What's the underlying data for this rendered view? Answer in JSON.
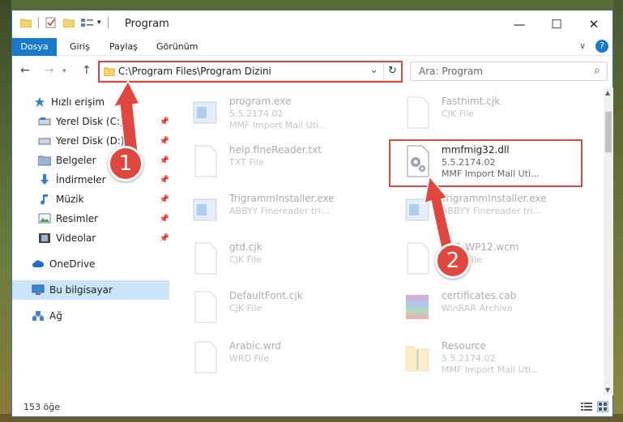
{
  "window": {
    "title": "Program",
    "minimize_icon": "—",
    "maximize_icon": "☐",
    "close_icon": "✕"
  },
  "ribbon": {
    "tabs": [
      "Dosya",
      "Giriş",
      "Paylaş",
      "Görünüm"
    ],
    "active_tab": "Dosya",
    "help_icon": "?",
    "expand_icon": "∨"
  },
  "nav": {
    "back": "←",
    "forward": "→",
    "up": "↑",
    "address": "C:\\Program Files\\Program Dizini",
    "dropdown": "⌄",
    "refresh": "↻",
    "search_placeholder": "Ara: Program",
    "search_icon": "⌕"
  },
  "sidebar": {
    "items": [
      {
        "label": "Hızlı erişim",
        "icon": "star-icon",
        "pinned": false
      },
      {
        "label": "Yerel Disk (C:)",
        "icon": "drive-icon",
        "pinned": true
      },
      {
        "label": "Yerel Disk (D:)",
        "icon": "drive-icon",
        "pinned": true
      },
      {
        "label": "Belgeler",
        "icon": "documents-icon",
        "pinned": true
      },
      {
        "label": "İndirmeler",
        "icon": "download-icon",
        "pinned": true
      },
      {
        "label": "Müzik",
        "icon": "music-icon",
        "pinned": true
      },
      {
        "label": "Resimler",
        "icon": "pictures-icon",
        "pinned": true
      },
      {
        "label": "Videolar",
        "icon": "videos-icon",
        "pinned": true
      },
      {
        "label": "OneDrive",
        "icon": "cloud-icon",
        "pinned": false
      },
      {
        "label": "Bu bilgisayar",
        "icon": "computer-icon",
        "pinned": false,
        "selected": true
      },
      {
        "label": "Ağ",
        "icon": "network-icon",
        "pinned": false
      }
    ],
    "pin_glyph": "📌"
  },
  "files": [
    {
      "name": "program.exe",
      "line2": "5.5.2174.02",
      "line3": "MMF Import Mail Uti...",
      "icon": "exe-icon"
    },
    {
      "name": "Fasthimt.cjk",
      "line2": "CJK File",
      "line3": "",
      "icon": "file-icon"
    },
    {
      "name": "help.fineReader.txt",
      "line2": "TXT File",
      "line3": "",
      "icon": "file-icon"
    },
    {
      "name": "mmfmig32.dll",
      "line2": "5.5.2174.02",
      "line3": "MMF Import Mail Uti...",
      "icon": "dll-icon",
      "highlighted": true
    },
    {
      "name": "TrigrammInstaller.exe",
      "line2": "ABBYY Finereader tri...",
      "line3": "",
      "icon": "exe-icon"
    },
    {
      "name": "TrigrammInstaller.exe",
      "line2": "ABBYY Finereader tri...",
      "line3": "",
      "icon": "exe-icon"
    },
    {
      "name": "gtd.cjk",
      "line2": "CJK File",
      "line3": "",
      "icon": "file-icon"
    },
    {
      "name": "SPC_WP12.wcm",
      "line2": "WCM File",
      "line3": "",
      "icon": "file-icon"
    },
    {
      "name": "DefaultFont.cjk",
      "line2": "CJK File",
      "line3": "",
      "icon": "file-icon"
    },
    {
      "name": "certificates.cab",
      "line2": "WinRAR Archive",
      "line3": "",
      "icon": "archive-icon"
    },
    {
      "name": "Arabic.wrd",
      "line2": "WRD File",
      "line3": "",
      "icon": "file-icon"
    },
    {
      "name": "Resource",
      "line2": "5.5.2174.02",
      "line3": "MMF Import Mail Uti...",
      "icon": "folder-zip-icon"
    }
  ],
  "status": {
    "count": "153 öğe"
  },
  "callouts": {
    "one": "1",
    "two": "2"
  },
  "colors": {
    "accent": "#1979ca",
    "selection": "#cce4f7",
    "callout": "#e0483f"
  }
}
